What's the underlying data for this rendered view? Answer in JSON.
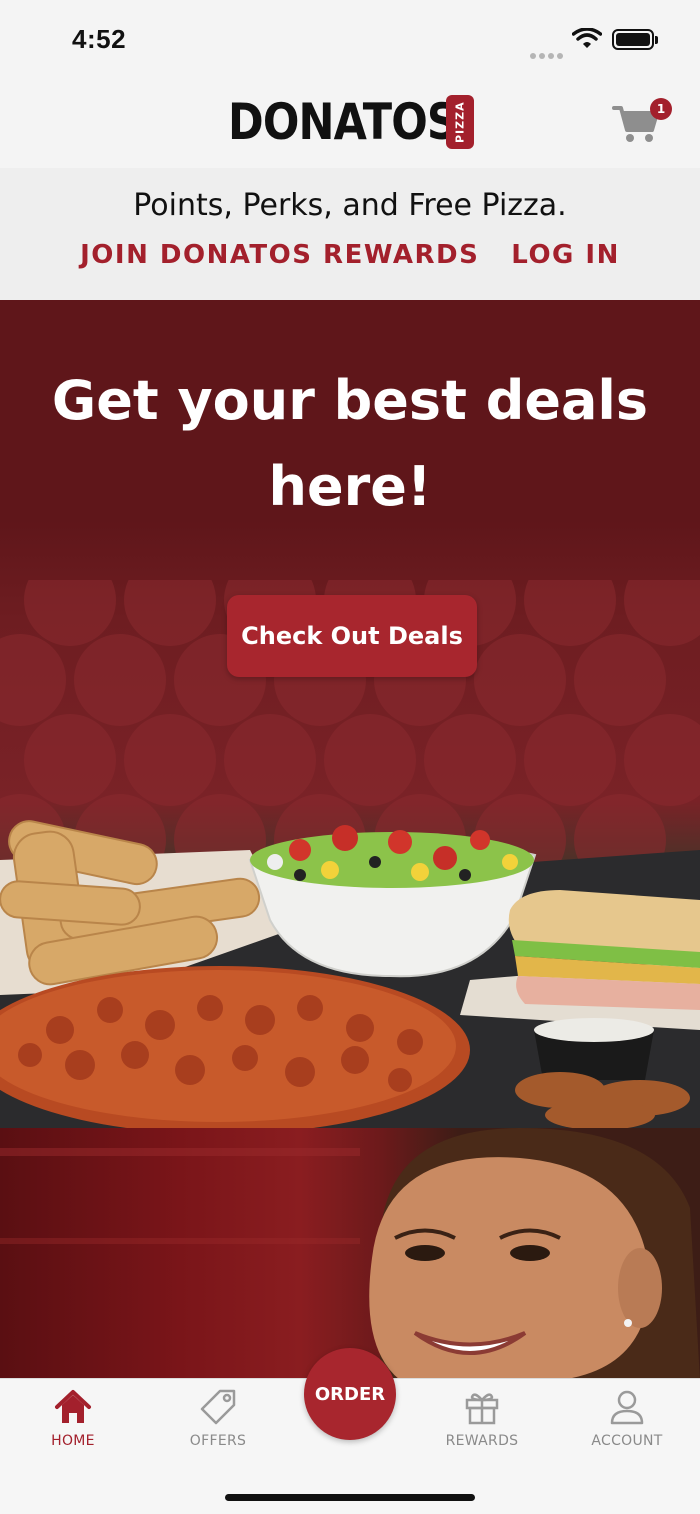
{
  "status_bar": {
    "time": "4:52"
  },
  "header": {
    "logo_text": "DONATOS",
    "logo_badge": "PIZZA",
    "cart_count": "1"
  },
  "promo": {
    "tagline": "Points, Perks, and Free Pizza.",
    "join_label": "JOIN DONATOS REWARDS",
    "login_label": "LOG IN"
  },
  "hero": {
    "title": "Get your best deals here!",
    "cta_label": "Check Out Deals"
  },
  "tab_bar": {
    "home": "HOME",
    "offers": "OFFERS",
    "order": "ORDER",
    "rewards": "REWARDS",
    "account": "ACCOUNT"
  },
  "icons": [
    "cart-icon",
    "home-icon",
    "tag-icon",
    "gift-icon",
    "person-icon",
    "wifi-icon",
    "battery-icon"
  ],
  "colors": {
    "brand_red": "#a3202c",
    "hero_maroon": "#5f161a",
    "inactive_gray": "#8a8a8a"
  }
}
